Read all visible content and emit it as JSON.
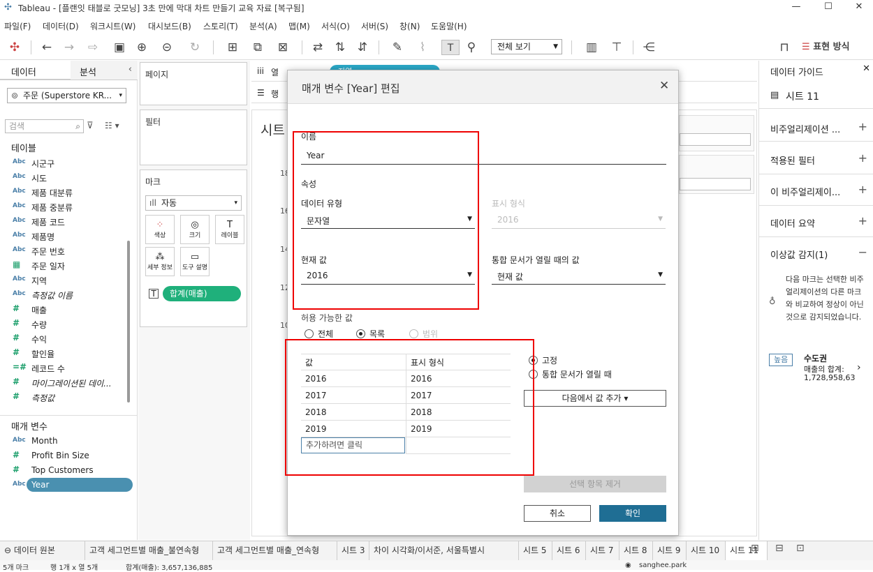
{
  "window": {
    "title": "Tableau - [플랜잇 태블로 굿모닝] 3초 만에 막대 차트 만들기 교육 자료 [복구됨]"
  },
  "menu": [
    "파일(F)",
    "데이터(D)",
    "워크시트(W)",
    "대시보드(B)",
    "스토리(T)",
    "분석(A)",
    "맵(M)",
    "서식(O)",
    "서버(S)",
    "창(N)",
    "도움말(H)"
  ],
  "toolbar": {
    "view_select": "전체 보기",
    "show_me": "표현 방식"
  },
  "left": {
    "tab_data": "데이터",
    "tab_analysis": "분석",
    "datasource": "주문 (Superstore KR...",
    "search_placeholder": "검색",
    "tables_header": "테이블",
    "fields": [
      {
        "icon": "Abc",
        "name": "시군구"
      },
      {
        "icon": "Abc",
        "name": "시도"
      },
      {
        "icon": "Abc",
        "name": "제품 대분류"
      },
      {
        "icon": "Abc",
        "name": "제품 중분류"
      },
      {
        "icon": "Abc",
        "name": "제품 코드"
      },
      {
        "icon": "Abc",
        "name": "제품명"
      },
      {
        "icon": "Abc",
        "name": "주문 번호"
      },
      {
        "icon": "▦",
        "name": "주문 일자"
      },
      {
        "icon": "Abc",
        "name": "지역"
      },
      {
        "icon": "Abc",
        "name": "측정값 이름"
      },
      {
        "icon": "#",
        "name": "매출"
      },
      {
        "icon": "#",
        "name": "수량"
      },
      {
        "icon": "#",
        "name": "수익"
      },
      {
        "icon": "#",
        "name": "할인율"
      },
      {
        "icon": "=#",
        "name": "레코드 수"
      },
      {
        "icon": "#",
        "name": "마이그레이션된 데이..."
      },
      {
        "icon": "#",
        "name": "측정값"
      }
    ],
    "params_header": "매개 변수",
    "params": [
      {
        "icon": "Abc",
        "name": "Month"
      },
      {
        "icon": "#",
        "name": "Profit Bin Size"
      },
      {
        "icon": "#",
        "name": "Top Customers"
      },
      {
        "icon": "Abc",
        "name": "Year"
      }
    ]
  },
  "shelves": {
    "pages": "페이지",
    "filters": "필터",
    "marks": "마크",
    "mark_type": "자동",
    "mark_buttons": [
      "색상",
      "크기",
      "레이블",
      "세부 정보",
      "도구 설명"
    ],
    "mark_pill": "합계(매출)",
    "columns": "열",
    "rows": "행",
    "columns_pill": "지역",
    "sheet_title": "시트",
    "axis_ticks": [
      "18",
      "16",
      "14",
      "12",
      "10"
    ]
  },
  "dialog": {
    "title": "매개 변수 [Year] 편집",
    "name_label": "이름",
    "name_value": "Year",
    "properties": "속성",
    "datatype_label": "데이터 유형",
    "datatype_value": "문자열",
    "display_format_label": "표시 형식",
    "display_format_value": "2016",
    "current_label": "현재 값",
    "current_value": "2016",
    "workbook_open_label": "통합 문서가 열릴 때의 값",
    "workbook_open_value": "현재 값",
    "allowable_label": "허용 가능한 값",
    "allowable_options": [
      "전체",
      "목록",
      "범위"
    ],
    "table_header_value": "값",
    "table_header_display": "표시 형식",
    "rows": [
      {
        "value": "2016",
        "display": "2016"
      },
      {
        "value": "2017",
        "display": "2017"
      },
      {
        "value": "2018",
        "display": "2018"
      },
      {
        "value": "2019",
        "display": "2019"
      }
    ],
    "add_placeholder": "추가하려면 클릭",
    "fixed_option": "고정",
    "on_open_option": "통합 문서가 열릴 때",
    "add_from_button": "다음에서 값 추가 ▾",
    "remove_button": "선택 항목 제거",
    "cancel_button": "취소",
    "ok_button": "확인"
  },
  "right": {
    "title": "데이터 가이드",
    "sheet": "시트 11",
    "items": [
      "비주얼리제이션 ...",
      "적용된 필터",
      "이 비주얼리제이...",
      "데이터 요약"
    ],
    "outlier_header": "이상값 감지(1)",
    "outlier_text": "다음 마크는 선택한 비주얼리제이션의 다른 마크와 비교하여 정상이 아닌 것으로 감지되었습니다.",
    "badge": "높음",
    "mark_name": "수도권",
    "mark_detail_1": "매출의 합계:",
    "mark_detail_2": "1,728,958,63"
  },
  "tabs": [
    "데이터 원본",
    "고객 세그먼트별 매출_불연속형",
    "고객 세그먼트별 매출_연속형",
    "시트 3",
    "차이 시각화/이서준, 서울특별시",
    "시트 5",
    "시트 6",
    "시트 7",
    "시트 8",
    "시트 9",
    "시트 10",
    "시트 11"
  ],
  "status": {
    "marks": "5개 마크",
    "rows": "행 1개 x 열 5개",
    "sum": "합계(매출): 3,657,136,885",
    "user": "sanghee.park"
  }
}
